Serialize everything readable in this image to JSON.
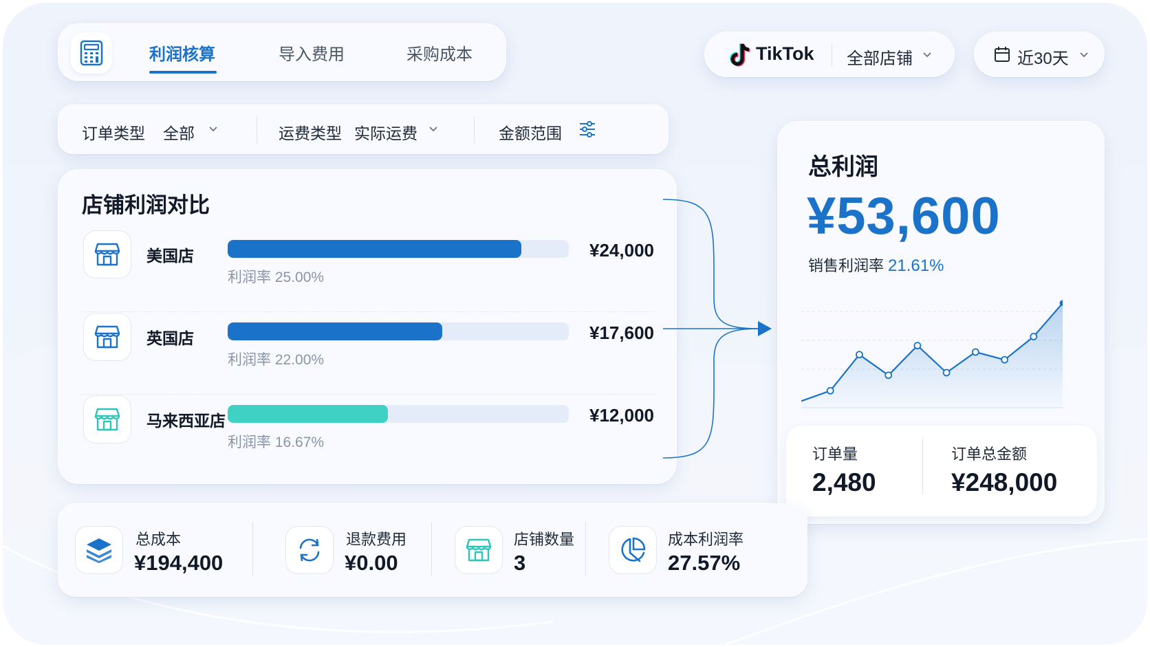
{
  "tabs": [
    {
      "label": "利润核算",
      "active": true
    },
    {
      "label": "导入费用",
      "active": false
    },
    {
      "label": "采购成本",
      "active": false
    }
  ],
  "platform": {
    "name": "TikTok",
    "store": "全部店铺"
  },
  "date_range": "近30天",
  "filters": {
    "order_type_label": "订单类型",
    "order_type_value": "全部",
    "shipping_type_label": "运费类型",
    "shipping_type_value": "实际运费",
    "amount_range_label": "金额范围"
  },
  "store_comparison": {
    "title": "店铺利润对比",
    "stores": [
      {
        "name": "美国店",
        "value": "¥24,000",
        "rate": "利润率 25.00%",
        "bar_fraction": 0.86,
        "color": "#1a73c8"
      },
      {
        "name": "英国店",
        "value": "¥17,600",
        "rate": "利润率 22.00%",
        "bar_fraction": 0.63,
        "color": "#1a73c8"
      },
      {
        "name": "马来西亚店",
        "value": "¥12,000",
        "rate": "利润率 16.67%",
        "bar_fraction": 0.47,
        "color": "#3ed1c4"
      }
    ]
  },
  "total_profit": {
    "title": "总利润",
    "value": "¥53,600",
    "rate_label": "销售利润率",
    "rate_value": "21.61%",
    "trend": [
      2,
      10,
      38,
      22,
      45,
      24,
      40,
      34,
      52,
      78
    ]
  },
  "orders": {
    "count_label": "订单量",
    "count_value": "2,480",
    "amount_label": "订单总金额",
    "amount_value": "¥248,000"
  },
  "stats": [
    {
      "label": "总成本",
      "value": "¥194,400",
      "icon": "layers-icon"
    },
    {
      "label": "退款费用",
      "value": "¥0.00",
      "icon": "refresh-icon"
    },
    {
      "label": "店铺数量",
      "value": "3",
      "icon": "store-icon"
    },
    {
      "label": "成本利润率",
      "value": "27.57%",
      "icon": "pie-clock-icon"
    }
  ],
  "colors": {
    "accent": "#1a73c8",
    "teal": "#3ed1c4",
    "track": "#e4ecfa"
  }
}
